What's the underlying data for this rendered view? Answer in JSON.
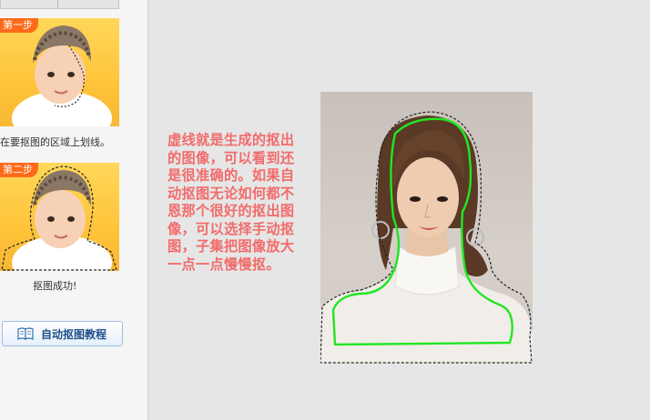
{
  "left_panel": {
    "step1": {
      "badge": "第一步",
      "caption": "在要抠图的区域上划线。"
    },
    "step2": {
      "badge": "第二步",
      "caption": "抠图成功!"
    },
    "tutorial_button": {
      "label": "自动抠图教程",
      "icon": "book-icon"
    }
  },
  "main": {
    "note": "虚线就是生成的抠出的图像，可以看到还是很准确的。如果自动抠图无论如何都不恩那个很好的抠出图像，可以选择手动抠图，子集把图像放大一点一点慢慢抠。"
  },
  "colors": {
    "note_text": "#f26b6b",
    "badge": "#ff6a1a",
    "selection_line": "#22e622",
    "button_text": "#1f4f8a"
  }
}
